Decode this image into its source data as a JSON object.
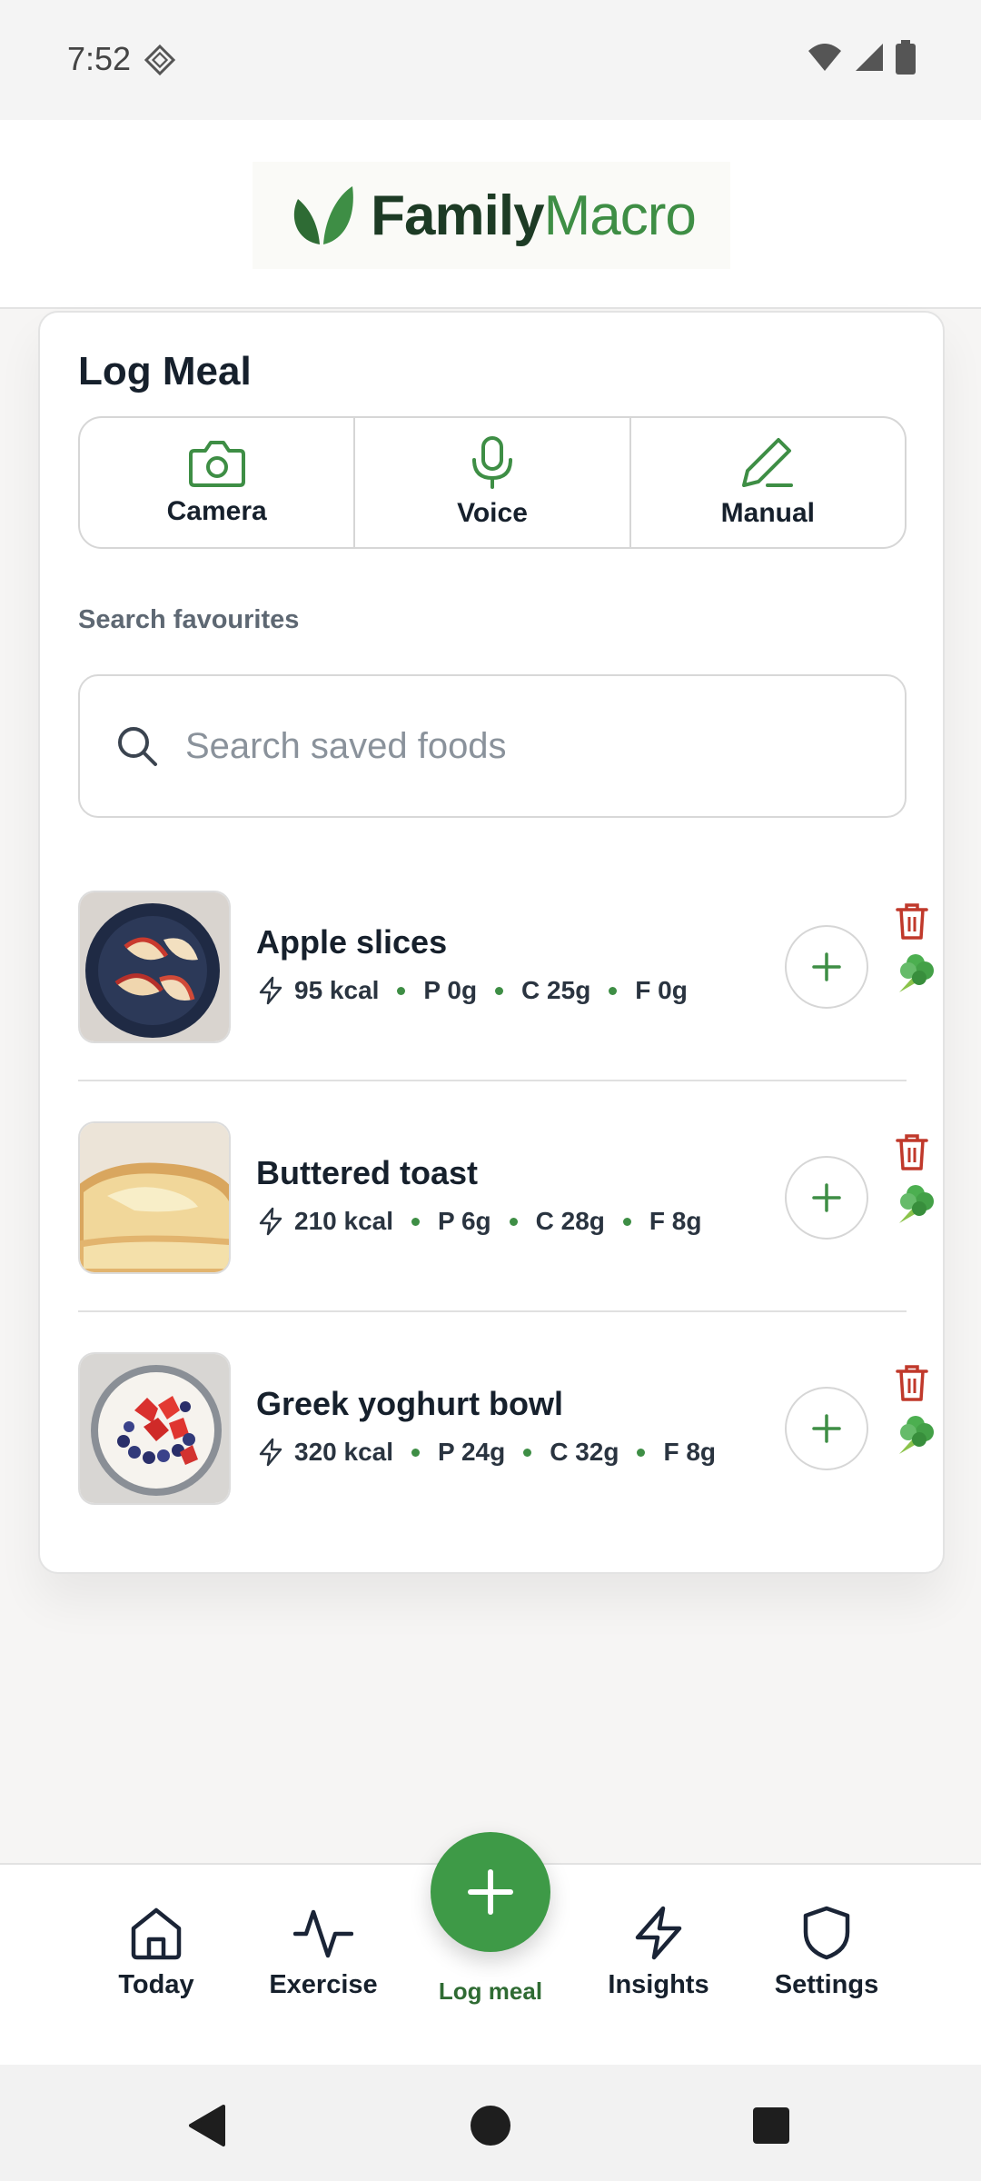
{
  "status_bar": {
    "time": "7:52"
  },
  "header": {
    "logo_word1": "Family",
    "logo_word2": "Macro"
  },
  "log_meal": {
    "title": "Log Meal",
    "options": [
      {
        "label": "Camera",
        "icon": "camera-icon"
      },
      {
        "label": "Voice",
        "icon": "mic-icon"
      },
      {
        "label": "Manual",
        "icon": "pencil-icon"
      }
    ],
    "search_label": "Search favourites",
    "search_placeholder": "Search saved foods",
    "search_value": ""
  },
  "foods": [
    {
      "name": "Apple slices",
      "kcal": "95 kcal",
      "protein": "P 0g",
      "carbs": "C 25g",
      "fat": "F 0g",
      "thumb": "apple-slices-photo"
    },
    {
      "name": "Buttered toast",
      "kcal": "210 kcal",
      "protein": "P 6g",
      "carbs": "C 28g",
      "fat": "F 8g",
      "thumb": "buttered-toast-photo"
    },
    {
      "name": "Greek yoghurt bowl",
      "kcal": "320 kcal",
      "protein": "P 24g",
      "carbs": "C 32g",
      "fat": "F 8g",
      "thumb": "greek-yoghurt-photo"
    }
  ],
  "bottom_nav": {
    "today": "Today",
    "exercise": "Exercise",
    "log_meal": "Log meal",
    "insights": "Insights",
    "settings": "Settings"
  },
  "colors": {
    "accent": "#3e9a47",
    "accent_dark": "#2f6b33",
    "delete": "#c0392b",
    "text": "#16202c"
  }
}
